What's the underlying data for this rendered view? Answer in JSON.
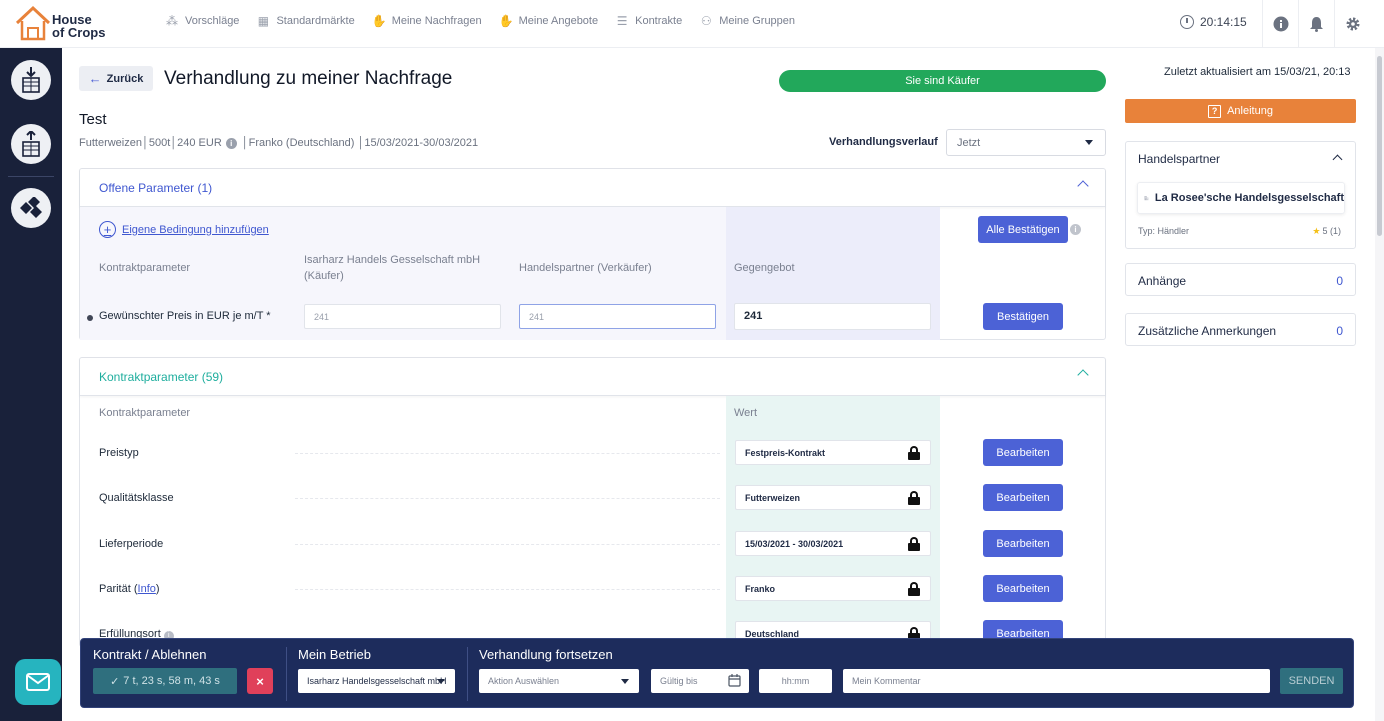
{
  "app": {
    "logo_line1": "House",
    "logo_line2": "of Crops",
    "brand_color": "#e8823a"
  },
  "nav": [
    {
      "label": "Vorschläge",
      "icon": "suggestions-icon"
    },
    {
      "label": "Standardmärkte",
      "icon": "markets-icon"
    },
    {
      "label": "Meine Nachfragen",
      "icon": "demand-icon"
    },
    {
      "label": "Meine Angebote",
      "icon": "offers-icon"
    },
    {
      "label": "Kontrakte",
      "icon": "contracts-icon"
    },
    {
      "label": "Meine Gruppen",
      "icon": "groups-icon"
    }
  ],
  "topbar": {
    "time": "20:14:15"
  },
  "page": {
    "back_label": "Zurück",
    "title": "Verhandlung zu meiner Nachfrage",
    "role_badge": "Sie sind Käufer",
    "role_color": "#22a85b",
    "subtitle": "Test",
    "meta_left": "Futterweizen│500t│240 EUR",
    "meta_right": "│Franko (Deutschland) │15/03/2021-30/03/2021",
    "history_label": "Verhandlungsverlauf",
    "history_value": "Jetzt"
  },
  "open_params": {
    "header": "Offene Parameter (1)",
    "add_condition": "Eigene Bedingung hinzufügen",
    "confirm_all": "Alle Bestätigen",
    "col_param": "Kontraktparameter",
    "col_buyer_line1": "Isarharz Handels Gesselschaft mbH",
    "col_buyer_line2": "(Käufer)",
    "col_seller": "Handelspartner (Verkäufer)",
    "col_counter": "Gegengebot",
    "row": {
      "label": "Gewünschter Preis in EUR je m/T *",
      "buyer_value": "241",
      "seller_value": "241",
      "counter_value": "241",
      "confirm": "Bestätigen"
    }
  },
  "contract_params": {
    "header": "Kontraktparameter (59)",
    "col_param": "Kontraktparameter",
    "col_value": "Wert",
    "edit_label": "Bearbeiten",
    "rows": [
      {
        "label": "Preistyp",
        "value": "Festpreis-Kontrakt"
      },
      {
        "label": "Qualitätsklasse",
        "value": "Futterweizen"
      },
      {
        "label": "Lieferperiode",
        "value": "15/03/2021 - 30/03/2021"
      },
      {
        "label": "Parität (",
        "link": "Info",
        "suffix": ")",
        "value": "Franko"
      },
      {
        "label": "Erfüllungsort",
        "value": "Deutschland"
      }
    ]
  },
  "right": {
    "updated": "Zuletzt aktualisiert am 15/03/21, 20:13",
    "guide": "Anleitung",
    "partner_header": "Handelspartner",
    "partner_name": "La Rosee'sche Handelsgesselschaft",
    "partner_type": "Typ: Händler",
    "partner_rating": "5 (1)",
    "attachments": "Anhänge",
    "attachments_count": "0",
    "notes": "Zusätzliche Anmerkungen",
    "notes_count": "0"
  },
  "bottom": {
    "sec1": "Kontrakt / Ablehnen",
    "timer": "7 t, 23 s, 58 m, 43 s",
    "sec2": "Mein Betrieb",
    "company": "Isarharz Handelsgesselschaft mbH",
    "sec3": "Verhandlung fortsetzen",
    "action_placeholder": "Aktion Auswählen",
    "valid_until": "Gültig bis",
    "time_placeholder": "hh:mm",
    "comment_placeholder": "Mein Kommentar",
    "send": "SENDEN"
  }
}
